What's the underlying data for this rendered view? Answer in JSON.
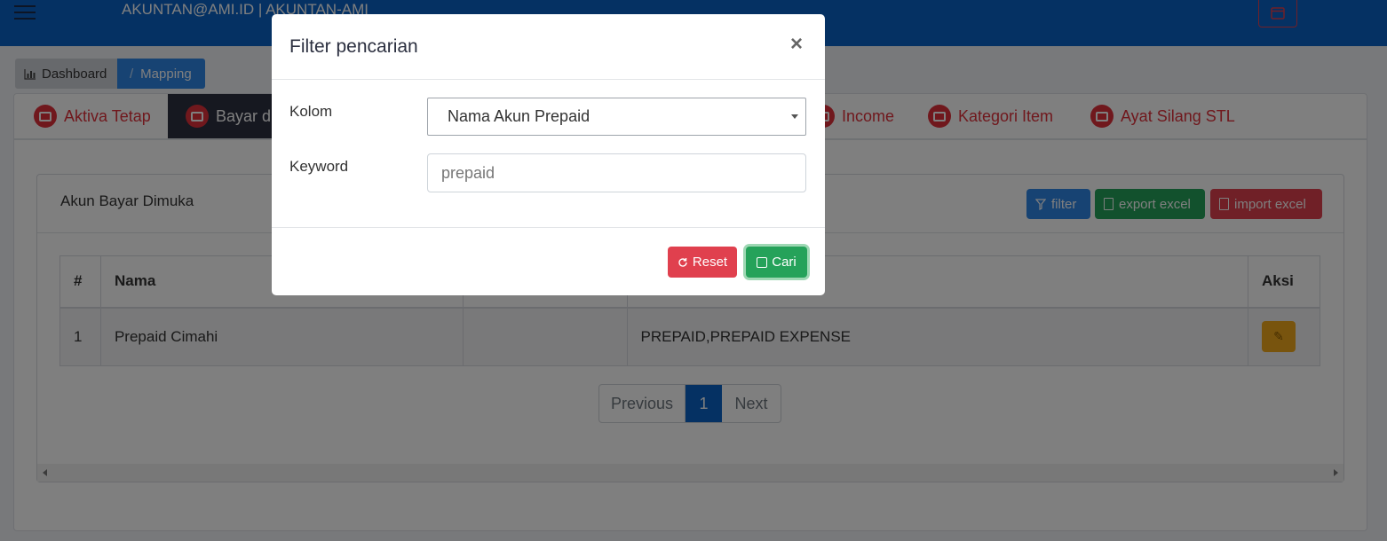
{
  "header": {
    "user": "AKUNTAN@AMI.ID | AKUNTAN-AMI"
  },
  "breadcrumb": {
    "items": [
      "Dashboard",
      "Mapping"
    ]
  },
  "tabs": [
    {
      "label": "Aktiva Tetap"
    },
    {
      "label": "Bayar di"
    },
    {
      "label": "Income"
    },
    {
      "label": "Kategori Item"
    },
    {
      "label": "Ayat Silang STL"
    }
  ],
  "panel": {
    "title": "Akun Bayar Dimuka",
    "filter_label": "filter",
    "export_label": "export excel",
    "import_label": "import excel"
  },
  "table": {
    "headers": [
      "#",
      "Nama",
      "",
      "",
      "Aksi"
    ],
    "rows": [
      {
        "no": "1",
        "nama": "Prepaid Cimahi",
        "col3": "",
        "keyword": "PREPAID,PREPAID EXPENSE"
      }
    ]
  },
  "pagination": {
    "previous": "Previous",
    "current": "1",
    "next": "Next"
  },
  "modal": {
    "title": "Filter pencarian",
    "close": "×",
    "kolom_label": "Kolom",
    "kolom_value": "Nama Akun Prepaid",
    "keyword_label": "Keyword",
    "keyword_placeholder": "prepaid",
    "reset_label": "Reset",
    "cari_label": "Cari"
  },
  "colors": {
    "primary": "#0a62c7",
    "danger": "#e0404e",
    "success": "#25a25a",
    "warning": "#f1a91c"
  }
}
